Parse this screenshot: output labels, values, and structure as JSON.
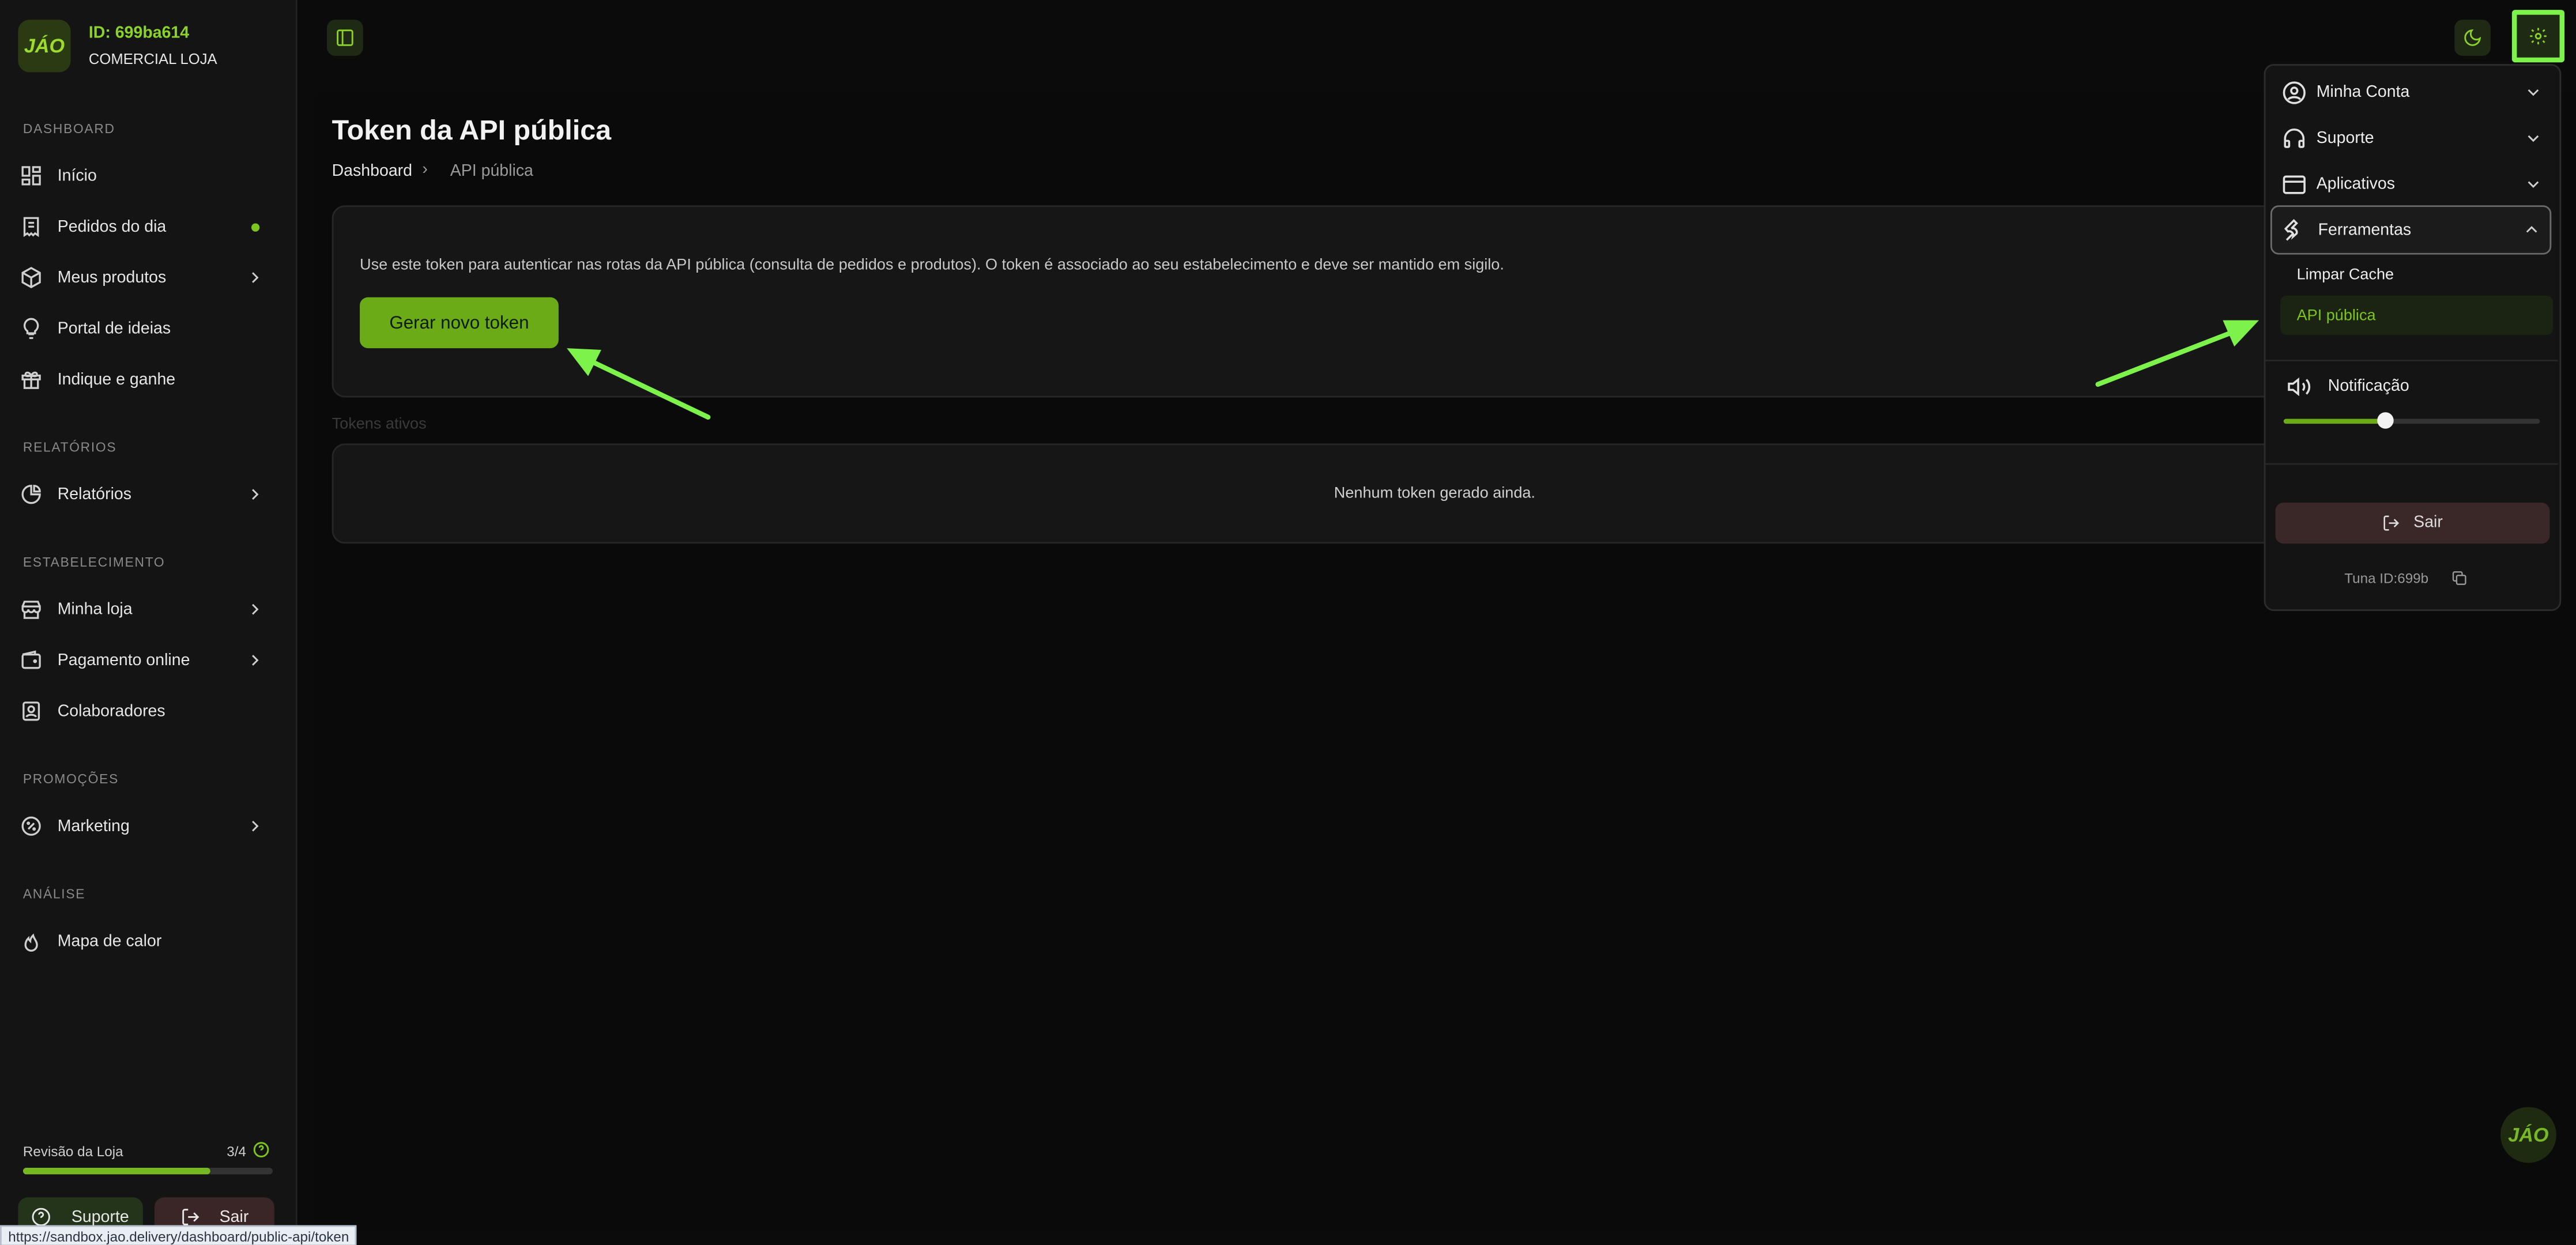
{
  "store": {
    "logo_text": "JÁO",
    "id_label": "ID: 699ba614",
    "name": "COMERCIAL LOJA"
  },
  "sidebar": {
    "sections": [
      {
        "title": "DASHBOARD",
        "items": [
          {
            "label": "Início",
            "icon": "layout-dashboard-icon"
          },
          {
            "label": "Pedidos do dia",
            "icon": "receipt-icon",
            "badge": "green-dot"
          },
          {
            "label": "Meus produtos",
            "icon": "package-icon",
            "chevron": true
          },
          {
            "label": "Portal de ideias",
            "icon": "lightbulb-icon"
          },
          {
            "label": "Indique e ganhe",
            "icon": "gift-icon"
          }
        ]
      },
      {
        "title": "RELATÓRIOS",
        "items": [
          {
            "label": "Relatórios",
            "icon": "pie-chart-icon",
            "chevron": true
          }
        ]
      },
      {
        "title": "ESTABELECIMENTO",
        "items": [
          {
            "label": "Minha loja",
            "icon": "store-icon",
            "chevron": true
          },
          {
            "label": "Pagamento online",
            "icon": "wallet-icon",
            "chevron": true
          },
          {
            "label": "Colaboradores",
            "icon": "contact-icon"
          }
        ]
      },
      {
        "title": "PROMOÇÕES",
        "items": [
          {
            "label": "Marketing",
            "icon": "badge-percent-icon",
            "chevron": true
          }
        ]
      },
      {
        "title": "ANÁLISE",
        "items": [
          {
            "label": "Mapa de calor",
            "icon": "flame-icon"
          }
        ]
      }
    ],
    "review": {
      "label": "Revisão da Loja",
      "count": "3/4",
      "progress": 0.75
    },
    "support_label": "Suporte",
    "logout_label": "Sair"
  },
  "page": {
    "title": "Token da API pública",
    "breadcrumb": [
      "Dashboard",
      "API pública"
    ],
    "description": "Use este token para autenticar nas rotas da API pública (consulta de pedidos e produtos). O token é associado ao seu estabelecimento e deve ser mantido em sigilo.",
    "generate_button": "Gerar novo token",
    "tokens_label": "Tokens ativos",
    "empty_message": "Nenhum token gerado ainda."
  },
  "menu": {
    "items": [
      {
        "label": "Minha Conta",
        "icon": "user-circle-icon",
        "expanded": false
      },
      {
        "label": "Suporte",
        "icon": "headphones-icon",
        "expanded": false
      },
      {
        "label": "Aplicativos",
        "icon": "app-window-icon",
        "expanded": false
      },
      {
        "label": "Ferramentas",
        "icon": "wrench-icon",
        "expanded": true
      }
    ],
    "tools_submenu": [
      "Limpar Cache",
      "API pública"
    ],
    "active_submenu": "API pública",
    "notification": {
      "label": "Notificação",
      "volume": 0.4
    },
    "logout_label": "Sair",
    "footer_id": "Tuna ID:699b"
  },
  "status_url": "https://sandbox.jao.delivery/dashboard/public-api/token",
  "fab_text": "JÁO",
  "colors": {
    "accent": "#6aab17",
    "accent_text": "#8bd32a",
    "highlight": "#7cf24b",
    "background": "#0a0a0a"
  }
}
